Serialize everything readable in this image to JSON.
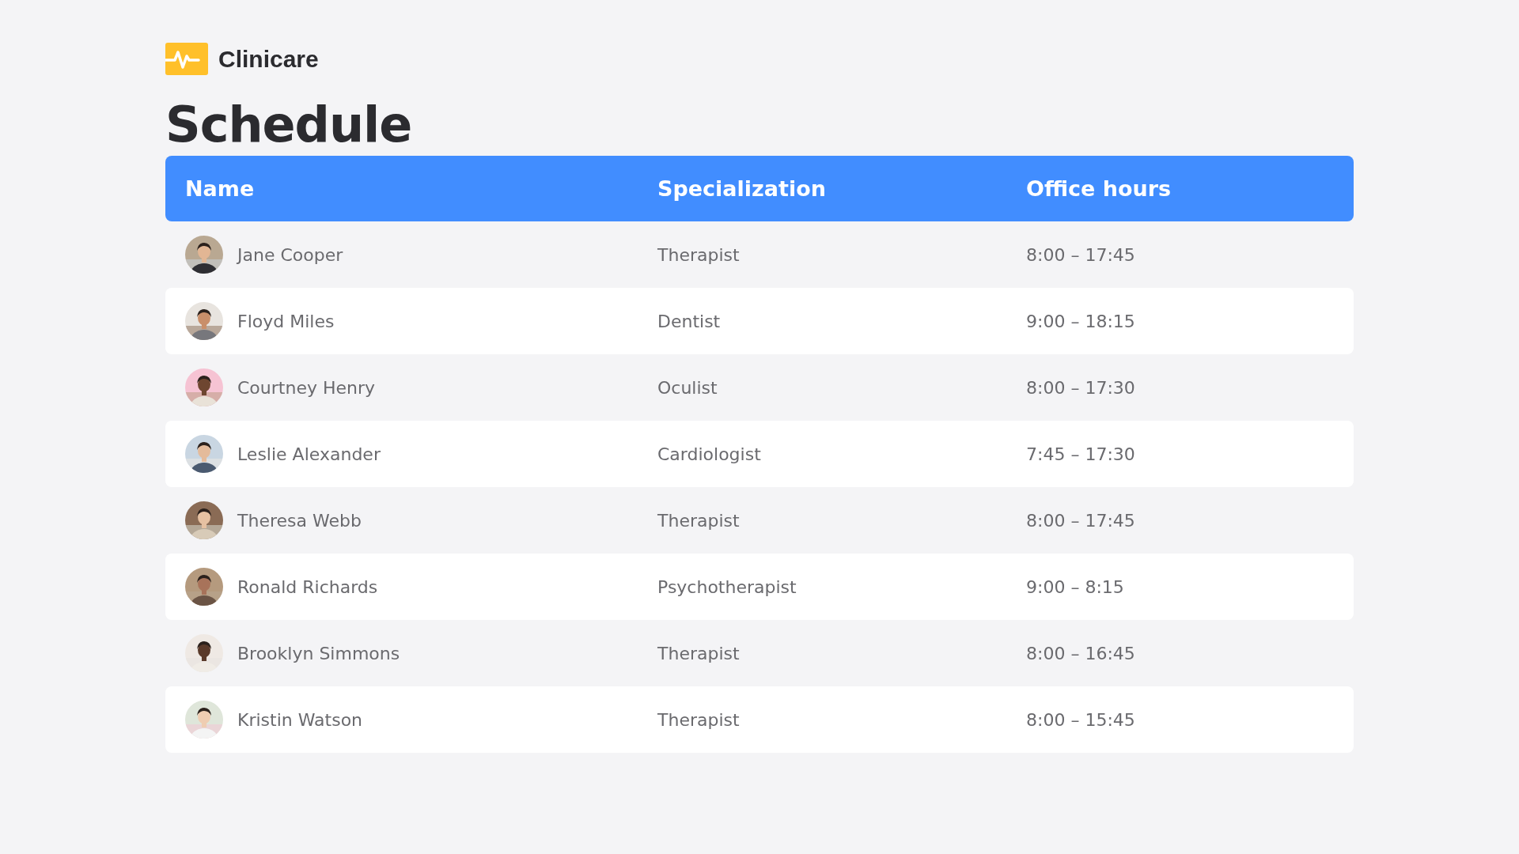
{
  "brand": {
    "name": "Clinicare"
  },
  "title": "Schedule",
  "table": {
    "columns": [
      "Name",
      "Specialization",
      "Office hours"
    ],
    "rows": [
      {
        "name": "Jane Cooper",
        "specialization": "Therapist",
        "hours": "8:00 – 17:45"
      },
      {
        "name": "Floyd Miles",
        "specialization": "Dentist",
        "hours": "9:00 – 18:15"
      },
      {
        "name": "Courtney Henry",
        "specialization": "Oculist",
        "hours": "8:00 – 17:30"
      },
      {
        "name": "Leslie Alexander",
        "specialization": "Cardiologist",
        "hours": "7:45 – 17:30"
      },
      {
        "name": "Theresa Webb",
        "specialization": "Therapist",
        "hours": "8:00 – 17:45"
      },
      {
        "name": "Ronald Richards",
        "specialization": "Psychotherapist",
        "hours": "9:00 – 8:15"
      },
      {
        "name": "Brooklyn Simmons",
        "specialization": "Therapist",
        "hours": "8:00 – 16:45"
      },
      {
        "name": "Kristin Watson",
        "specialization": "Therapist",
        "hours": "8:00 – 15:45"
      }
    ]
  }
}
